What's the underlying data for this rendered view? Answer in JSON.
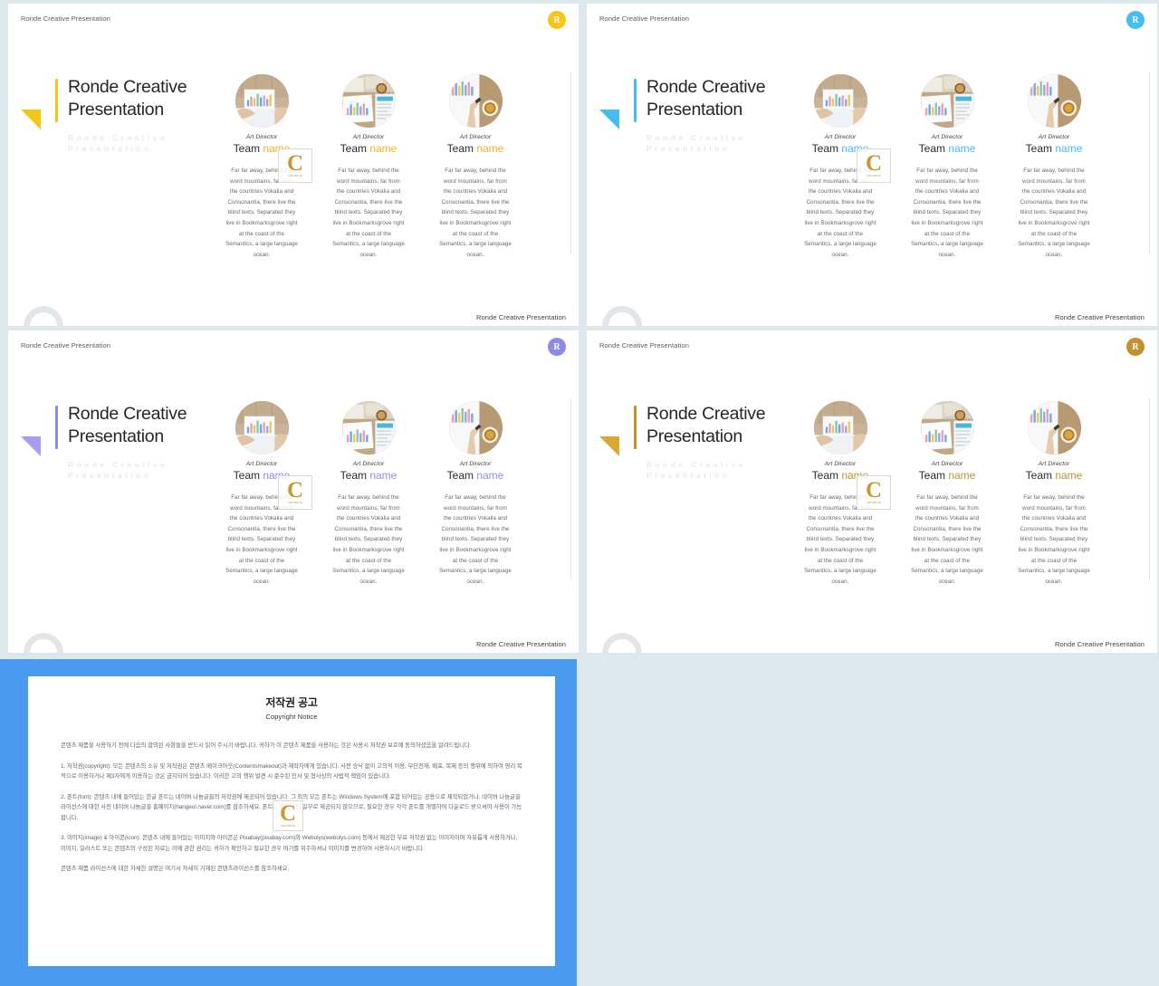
{
  "canvas": {
    "background": "#dce8ec"
  },
  "slides": [
    {
      "id": "slide-1",
      "header": "Ronde Creative Presentation",
      "footer": "Ronde Creative Presentation",
      "badge_label": "R",
      "badge_color": "#f5c518",
      "accent_color": "#f5c518",
      "title": "Ronde Creative Presentation",
      "title_ghost": "Ronde Creative Presentation",
      "flag_color": "#f5c518",
      "name_highlight_color": "#f0b323",
      "members": [
        {
          "role": "Art Director",
          "name_plain": "Team ",
          "name_highlight": "name",
          "desc": "Far far away, behind the word mountains, far from the countries Vokalia and Consonantia, there live the blind texts. Separated they live in Bookmarksgrove right at the coast of the Semantics, a large language ocean.",
          "photo": "chart-paper-hand-photo"
        },
        {
          "role": "Art Director",
          "name_plain": "Team ",
          "name_highlight": "name",
          "desc": "Far far away, behind the word mountains, far from the countries Vokalia and Consonantia, there live the blind texts. Separated they live in Bookmarksgrove right at the coast of the Semantics, a large language ocean.",
          "photo": "desk-charts-coffee-photo"
        },
        {
          "role": "Art Director",
          "name_plain": "Team ",
          "name_highlight": "name",
          "desc": "Far far away, behind the word mountains, far from the countries Vokalia and Consonantia, there live the blind texts. Separated they live in Bookmarksgrove right at the coast of the Semantics, a large language ocean.",
          "photo": "hand-pointing-chart-photo"
        }
      ]
    },
    {
      "id": "slide-2",
      "header": "Ronde Creative Presentation",
      "footer": "Ronde Creative Presentation",
      "badge_label": "R",
      "badge_color": "#45bdee",
      "accent_color": "#45bdee",
      "title": "Ronde Creative Presentation",
      "title_ghost": "Ronde Creative Presentation",
      "flag_color": "#45bdee",
      "name_highlight_color": "#45bdee",
      "members": [
        {
          "role": "Art Director",
          "name_plain": "Team ",
          "name_highlight": "name",
          "desc": "Far far away, behind the word mountains, far from the countries Vokalia and Consonantia, there live the blind texts. Separated they live in Bookmarksgrove right at the coast of the Semantics, a large language ocean.",
          "photo": "chart-paper-hand-photo"
        },
        {
          "role": "Art Director",
          "name_plain": "Team ",
          "name_highlight": "name",
          "desc": "Far far away, behind the word mountains, far from the countries Vokalia and Consonantia, there live the blind texts. Separated they live in Bookmarksgrove right at the coast of the Semantics, a large language ocean.",
          "photo": "desk-charts-coffee-photo"
        },
        {
          "role": "Art Director",
          "name_plain": "Team ",
          "name_highlight": "name",
          "desc": "Far far away, behind the word mountains, far from the countries Vokalia and Consonantia, there live the blind texts. Separated they live in Bookmarksgrove right at the coast of the Semantics, a large language ocean.",
          "photo": "hand-pointing-chart-photo"
        }
      ]
    },
    {
      "id": "slide-3",
      "header": "Ronde Creative Presentation",
      "footer": "Ronde Creative Presentation",
      "badge_label": "R",
      "badge_color": "#8c8ce8",
      "accent_color": "#8c8ce8",
      "title": "Ronde Creative Presentation",
      "title_ghost": "Ronde Creative Presentation",
      "flag_color": "#a99bf0",
      "name_highlight_color": "#8c8ce8",
      "members": [
        {
          "role": "Art Director",
          "name_plain": "Team ",
          "name_highlight": "name",
          "desc": "Far far away, behind the word mountains, far from the countries Vokalia and Consonantia, there live the blind texts. Separated they live in Bookmarksgrove right at the coast of the Semantics, a large language ocean.",
          "photo": "chart-paper-hand-photo"
        },
        {
          "role": "Art Director",
          "name_plain": "Team ",
          "name_highlight": "name",
          "desc": "Far far away, behind the word mountains, far from the countries Vokalia and Consonantia, there live the blind texts. Separated they live in Bookmarksgrove right at the coast of the Semantics, a large language ocean.",
          "photo": "desk-charts-coffee-photo"
        },
        {
          "role": "Art Director",
          "name_plain": "Team ",
          "name_highlight": "name",
          "desc": "Far far away, behind the word mountains, far from the countries Vokalia and Consonantia, there live the blind texts. Separated they live in Bookmarksgrove right at the coast of the Semantics, a large language ocean.",
          "photo": "hand-pointing-chart-photo"
        }
      ]
    },
    {
      "id": "slide-4",
      "header": "Ronde Creative Presentation",
      "footer": "Ronde Creative Presentation",
      "badge_label": "R",
      "badge_color": "#c09330",
      "accent_color": "#c09330",
      "title": "Ronde Creative Presentation",
      "title_ghost": "Ronde Creative Presentation",
      "flag_color": "#d9a836",
      "name_highlight_color": "#c09330",
      "members": [
        {
          "role": "Art Director",
          "name_plain": "Team ",
          "name_highlight": "name",
          "desc": "Far far away, behind the word mountains, far from the countries Vokalia and Consonantia, there live the blind texts. Separated they live in Bookmarksgrove right at the coast of the Semantics, a large language ocean.",
          "photo": "chart-paper-hand-photo"
        },
        {
          "role": "Art Director",
          "name_plain": "Team ",
          "name_highlight": "name",
          "desc": "Far far away, behind the word mountains, far from the countries Vokalia and Consonantia, there live the blind texts. Separated they live in Bookmarksgrove right at the coast of the Semantics, a large language ocean.",
          "photo": "desk-charts-coffee-photo"
        },
        {
          "role": "Art Director",
          "name_plain": "Team ",
          "name_highlight": "name",
          "desc": "Far far away, behind the word mountains, far from the countries Vokalia and Consonantia, there live the blind texts. Separated they live in Bookmarksgrove right at the coast of the Semantics, a large language ocean.",
          "photo": "hand-pointing-chart-photo"
        }
      ]
    }
  ],
  "watermark": {
    "letter": "C",
    "caption": "contents",
    "color": "#c59a30"
  },
  "copyright_doc": {
    "panel_color": "#4a9af0",
    "title": "저작권 공고",
    "subtitle": "Copyright Notice",
    "paragraphs": [
      "콘텐츠 제품을 사용하기 전에 다음의 합의된 사항들을 반드시 읽어 주시기 바랍니다. 귀하가 이 콘텐츠 제품을 사용하는 것은 사용시 저작권 보호에 동의하셨음을 알려드립니다.",
      "1. 저작권(copyright): 모든 콘텐츠의 소유 및 저작권은 콘텐츠 메이크아웃(Contentsmakeout)과 제작자에게 있습니다. 사전 승낙 없이 고의적 이용, 무단전재, 배포, 복제 등의 행위에 의하여 영리 목적으로 이용하거나 제3자에게 이용하는 것은 금지되어 있습니다. 이러한 고의 행위 발견 시 준수된 민사 및 형사상의 사법적 책임이 있습니다.",
      "2. 폰트(font): 콘텐츠 내에 들어있는 한글 폰트는 네이버 나눔글꼴의 저작권에 제공되어 있습니다. 그 외의 모든 폰트는 Windows System에 포함 되어있는 공용으로 제작되었거나, 네이버 나눔글꼴 라이선스에 대한 사전 네이버 나눔글꼴 홈페이지(hangeul.naver.com)를 참조하세요. 폰트는 콘텐츠의 일부로 제공되지 않으므로, 필요한 경우 각각 폰트를 개별하여 다운로드 받으셔야 사용이 가능합니다.",
      "3. 이미지(image) & 아이콘(icon): 콘텐츠 내에 들어있는 이미지와 아이콘은 Pixabay(pixabay.com)와 Webolys(webolys.com) 등에서 제공한 무료 저작권 없는 이미지이며 자유롭게 사용하거나, 이미지, 일러스트 또는 콘텐츠의 구성된 자료는 이에 관한 권리는 귀하가 확인하고 필요한 경우 여기를 위주하셔나 이미지를 변경하여 사용하시기 바랍니다.",
      "콘텐츠 제품 라이선스에 대한 자세한 설명은 여기서 자세히 기재된 콘텐츠라이선스를 참조하세요."
    ]
  }
}
